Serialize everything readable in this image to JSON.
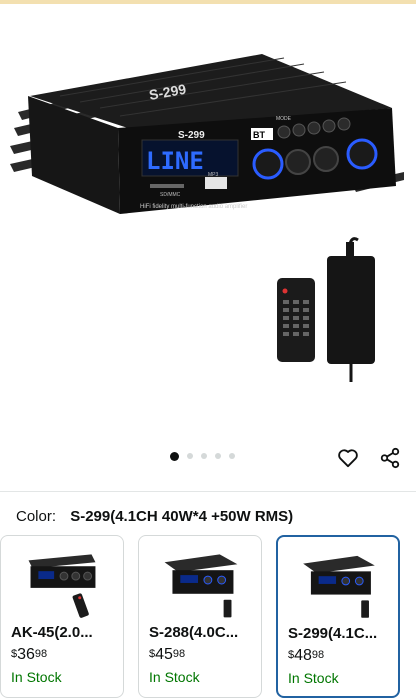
{
  "product": {
    "model_badge": "S-299",
    "display_text": "LINE",
    "bt_badge": "BT",
    "sd_label": "SD/MMC",
    "mp3_label": "MP3",
    "tagline": "HiFi fidelity multi-function audio amplifier",
    "knob_labels": [
      "CH-A/B VOL",
      "BASS",
      "TREBLE",
      "CH-C/D VOL"
    ],
    "mode_label": "MODE"
  },
  "gallery": {
    "total_images": 5,
    "active_index": 0
  },
  "actions": {
    "favorite_icon": "heart-icon",
    "share_icon": "share-icon"
  },
  "color_selector": {
    "label": "Color:",
    "selected_value": "S-299(4.1CH 40W*4 +50W RMS)"
  },
  "variants": [
    {
      "name": "AK-45(2.0...",
      "currency": "$",
      "price_whole": "36",
      "price_fraction": "98",
      "stock": "In Stock",
      "selected": false
    },
    {
      "name": "S-288(4.0C...",
      "currency": "$",
      "price_whole": "45",
      "price_fraction": "98",
      "stock": "In Stock",
      "selected": false
    },
    {
      "name": "S-299(4.1C...",
      "currency": "$",
      "price_whole": "48",
      "price_fraction": "98",
      "stock": "In Stock",
      "selected": true
    }
  ],
  "colors": {
    "stock_green": "#007600",
    "selected_border": "#2162a1",
    "display_blue": "#2e6bff"
  }
}
